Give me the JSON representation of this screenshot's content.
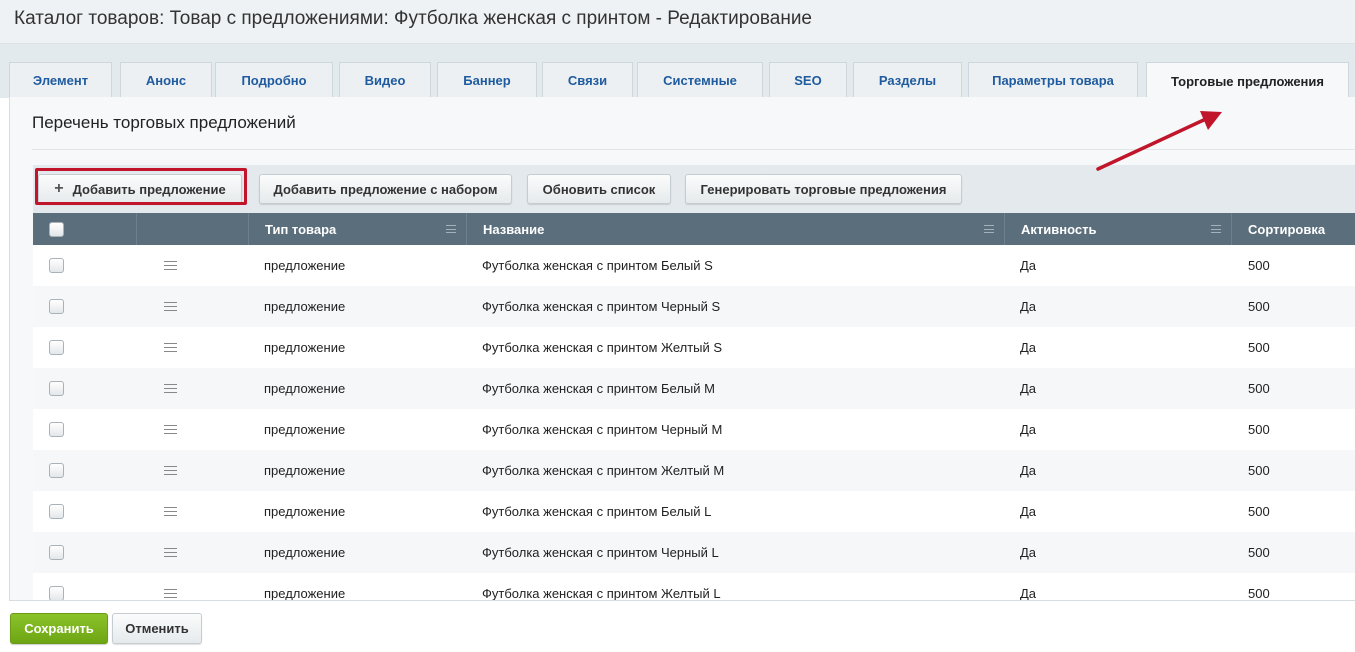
{
  "page": {
    "title": "Каталог товаров: Товар с предложениями: Футболка женская с принтом - Редактирование"
  },
  "tabs": [
    {
      "label": "Элемент"
    },
    {
      "label": "Анонс"
    },
    {
      "label": "Подробно"
    },
    {
      "label": "Видео"
    },
    {
      "label": "Баннер"
    },
    {
      "label": "Связи"
    },
    {
      "label": "Системные"
    },
    {
      "label": "SEO"
    },
    {
      "label": "Разделы"
    },
    {
      "label": "Параметры товара"
    },
    {
      "label": "Торговые предложения",
      "active": true
    }
  ],
  "section": {
    "title": "Перечень торговых предложений"
  },
  "toolbar": {
    "add_offer": "Добавить предложение",
    "add_offer_set": "Добавить предложение с набором",
    "refresh_list": "Обновить список",
    "generate_offers": "Генерировать торговые предложения"
  },
  "table": {
    "columns": [
      "Тип товара",
      "Название",
      "Активность",
      "Сортировка"
    ],
    "rows": [
      {
        "type": "предложение",
        "name": "Футболка женская с принтом Белый S",
        "active": "Да",
        "sort": "500"
      },
      {
        "type": "предложение",
        "name": "Футболка женская с принтом Черный S",
        "active": "Да",
        "sort": "500"
      },
      {
        "type": "предложение",
        "name": "Футболка женская с принтом Желтый S",
        "active": "Да",
        "sort": "500"
      },
      {
        "type": "предложение",
        "name": "Футболка женская с принтом Белый M",
        "active": "Да",
        "sort": "500"
      },
      {
        "type": "предложение",
        "name": "Футболка женская с принтом Черный M",
        "active": "Да",
        "sort": "500"
      },
      {
        "type": "предложение",
        "name": "Футболка женская с принтом Желтый M",
        "active": "Да",
        "sort": "500"
      },
      {
        "type": "предложение",
        "name": "Футболка женская с принтом Белый L",
        "active": "Да",
        "sort": "500"
      },
      {
        "type": "предложение",
        "name": "Футболка женская с принтом Черный L",
        "active": "Да",
        "sort": "500"
      },
      {
        "type": "предложение",
        "name": "Футболка женская с принтом Желтый L",
        "active": "Да",
        "sort": "500"
      }
    ]
  },
  "footer": {
    "save": "Сохранить",
    "cancel": "Отменить"
  },
  "colors": {
    "highlight": "#c0152a",
    "save_green": "#7ab51d",
    "tab_link": "#1f5b9e",
    "table_header": "#5b6e7c"
  }
}
